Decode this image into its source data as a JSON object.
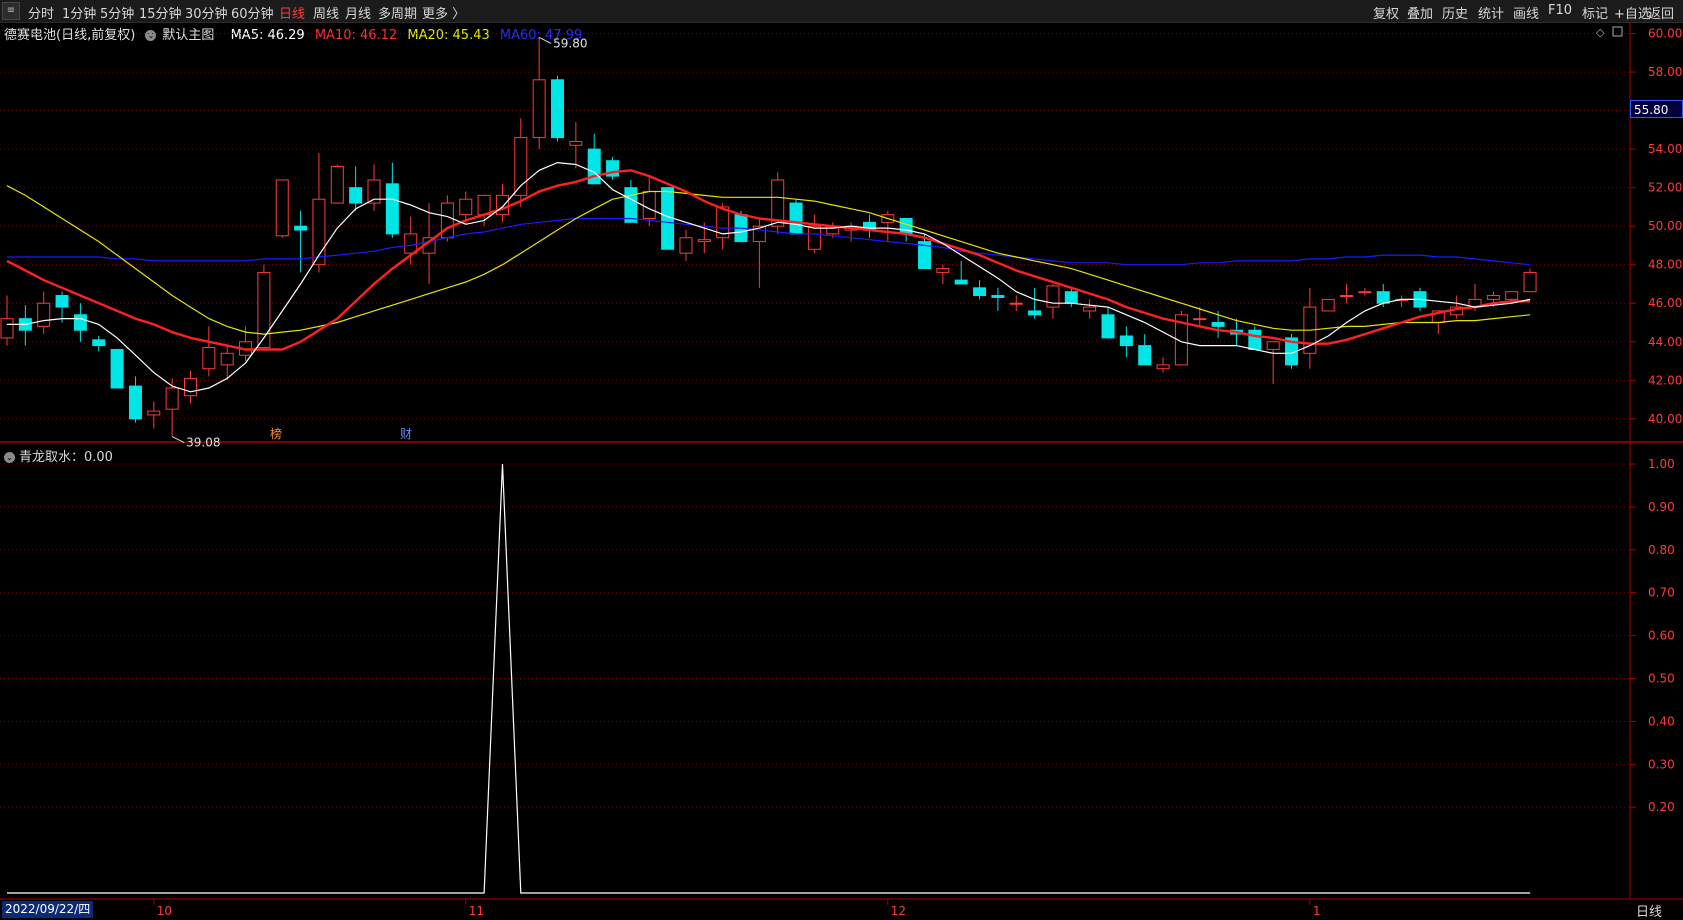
{
  "toolbar": {
    "menu_icon": "menu-icon",
    "periods": [
      "分时",
      "1分钟",
      "5分钟",
      "15分钟",
      "30分钟",
      "60分钟",
      "日线",
      "周线",
      "月线",
      "多周期",
      "更多 〉"
    ],
    "active_period": "日线",
    "right_buttons": [
      "复权",
      "叠加",
      "历史",
      "统计",
      "画线",
      "F10",
      "标记",
      "+自选",
      "返回"
    ]
  },
  "main_chart": {
    "stock_name": "德赛电池(日线,前复权)",
    "template": "默认主图",
    "ma5_label": "MA5: 46.29",
    "ma10_label": "MA10: 46.12",
    "ma20_label": "MA20: 45.43",
    "ma60_label": "MA60: 47.99",
    "high_label": "59.80",
    "low_label": "39.08",
    "current_price": "55.80",
    "marker_1": "榜",
    "marker_2": "财"
  },
  "indicator": {
    "label": "青龙取水：0.00"
  },
  "bottom": {
    "date": "2022/09/22/四",
    "period": "日线"
  },
  "colors": {
    "up": "#ff3a3a",
    "down": "#00e5e5",
    "ma5": "#ffffff",
    "ma10": "#ff2020",
    "ma20": "#e5e500",
    "ma60": "#1a1aff",
    "grid": "#7a0000",
    "axis": "#aa0000"
  },
  "chart_data": [
    {
      "type": "candlestick",
      "title": "",
      "ylim": [
        38.9,
        60.6
      ],
      "y_ticks": [
        40,
        42,
        44,
        46,
        48,
        50,
        52,
        54,
        56,
        58,
        60
      ],
      "x_labels": [
        {
          "label": "10",
          "index": 8
        },
        {
          "label": "11",
          "index": 25
        },
        {
          "label": "12",
          "index": 48
        },
        {
          "label": "1",
          "index": 71
        }
      ],
      "candles": [
        {
          "o": 44.2,
          "h": 46.4,
          "l": 43.8,
          "c": 45.2
        },
        {
          "o": 45.2,
          "h": 45.9,
          "l": 43.8,
          "c": 44.6
        },
        {
          "o": 44.8,
          "h": 46.6,
          "l": 44.4,
          "c": 46.0
        },
        {
          "o": 46.4,
          "h": 46.6,
          "l": 45.0,
          "c": 45.8
        },
        {
          "o": 45.4,
          "h": 46.0,
          "l": 44.0,
          "c": 44.6
        },
        {
          "o": 44.1,
          "h": 44.3,
          "l": 43.5,
          "c": 43.8
        },
        {
          "o": 43.6,
          "h": 43.6,
          "l": 41.6,
          "c": 41.6
        },
        {
          "o": 41.7,
          "h": 42.2,
          "l": 39.8,
          "c": 40.0
        },
        {
          "o": 40.2,
          "h": 40.9,
          "l": 39.5,
          "c": 40.4
        },
        {
          "o": 40.5,
          "h": 42.1,
          "l": 39.1,
          "c": 41.6
        },
        {
          "o": 41.2,
          "h": 42.5,
          "l": 40.8,
          "c": 42.1
        },
        {
          "o": 42.6,
          "h": 44.8,
          "l": 42.2,
          "c": 43.7
        },
        {
          "o": 42.8,
          "h": 43.8,
          "l": 42.0,
          "c": 43.4
        },
        {
          "o": 43.3,
          "h": 44.8,
          "l": 43.0,
          "c": 44.0
        },
        {
          "o": 43.7,
          "h": 48.0,
          "l": 43.6,
          "c": 47.6
        },
        {
          "o": 49.5,
          "h": 52.4,
          "l": 49.4,
          "c": 52.4
        },
        {
          "o": 50.0,
          "h": 50.8,
          "l": 47.6,
          "c": 49.8
        },
        {
          "o": 48.0,
          "h": 53.8,
          "l": 47.6,
          "c": 51.4
        },
        {
          "o": 51.2,
          "h": 53.2,
          "l": 51.2,
          "c": 53.1
        },
        {
          "o": 52.0,
          "h": 53.1,
          "l": 50.8,
          "c": 51.2
        },
        {
          "o": 51.2,
          "h": 53.2,
          "l": 50.8,
          "c": 52.4
        },
        {
          "o": 52.2,
          "h": 53.3,
          "l": 49.4,
          "c": 49.6
        },
        {
          "o": 48.6,
          "h": 50.5,
          "l": 48.0,
          "c": 49.6
        },
        {
          "o": 48.6,
          "h": 51.2,
          "l": 47.0,
          "c": 49.4
        },
        {
          "o": 49.4,
          "h": 51.6,
          "l": 49.2,
          "c": 51.2
        },
        {
          "o": 50.6,
          "h": 51.8,
          "l": 50.1,
          "c": 51.4
        },
        {
          "o": 50.6,
          "h": 51.6,
          "l": 50.0,
          "c": 51.6
        },
        {
          "o": 50.6,
          "h": 52.2,
          "l": 50.2,
          "c": 51.6
        },
        {
          "o": 51.6,
          "h": 55.6,
          "l": 51.0,
          "c": 54.6
        },
        {
          "o": 54.6,
          "h": 59.8,
          "l": 54.0,
          "c": 57.6
        },
        {
          "o": 57.6,
          "h": 57.8,
          "l": 54.4,
          "c": 54.6
        },
        {
          "o": 54.2,
          "h": 55.4,
          "l": 53.0,
          "c": 54.4
        },
        {
          "o": 54.0,
          "h": 54.8,
          "l": 52.2,
          "c": 52.2
        },
        {
          "o": 53.4,
          "h": 53.6,
          "l": 52.4,
          "c": 52.6
        },
        {
          "o": 52.0,
          "h": 52.4,
          "l": 50.2,
          "c": 50.2
        },
        {
          "o": 50.4,
          "h": 52.6,
          "l": 50.0,
          "c": 51.8
        },
        {
          "o": 52.0,
          "h": 52.0,
          "l": 48.8,
          "c": 48.8
        },
        {
          "o": 48.6,
          "h": 49.8,
          "l": 48.2,
          "c": 49.4
        },
        {
          "o": 49.2,
          "h": 50.2,
          "l": 48.6,
          "c": 49.3
        },
        {
          "o": 49.4,
          "h": 51.2,
          "l": 48.8,
          "c": 51.0
        },
        {
          "o": 50.6,
          "h": 50.8,
          "l": 49.2,
          "c": 49.2
        },
        {
          "o": 49.2,
          "h": 50.4,
          "l": 46.8,
          "c": 50.0
        },
        {
          "o": 50.0,
          "h": 52.8,
          "l": 49.6,
          "c": 52.4
        },
        {
          "o": 51.2,
          "h": 51.4,
          "l": 49.6,
          "c": 49.6
        },
        {
          "o": 48.8,
          "h": 50.6,
          "l": 48.6,
          "c": 50.0
        },
        {
          "o": 49.6,
          "h": 50.2,
          "l": 49.4,
          "c": 50.0
        },
        {
          "o": 49.8,
          "h": 50.2,
          "l": 49.2,
          "c": 50.0
        },
        {
          "o": 50.2,
          "h": 50.6,
          "l": 49.4,
          "c": 49.8
        },
        {
          "o": 50.2,
          "h": 50.8,
          "l": 49.2,
          "c": 50.6
        },
        {
          "o": 50.4,
          "h": 50.4,
          "l": 49.2,
          "c": 49.6
        },
        {
          "o": 49.2,
          "h": 49.6,
          "l": 47.8,
          "c": 47.8
        },
        {
          "o": 47.6,
          "h": 48.0,
          "l": 47.0,
          "c": 47.8
        },
        {
          "o": 47.2,
          "h": 48.2,
          "l": 47.0,
          "c": 47.0
        },
        {
          "o": 46.8,
          "h": 47.2,
          "l": 46.2,
          "c": 46.4
        },
        {
          "o": 46.4,
          "h": 46.8,
          "l": 45.6,
          "c": 46.3
        },
        {
          "o": 46.0,
          "h": 46.4,
          "l": 45.6,
          "c": 46.0
        },
        {
          "o": 45.6,
          "h": 46.8,
          "l": 45.2,
          "c": 45.4
        },
        {
          "o": 45.8,
          "h": 47.0,
          "l": 45.2,
          "c": 46.9
        },
        {
          "o": 46.6,
          "h": 46.8,
          "l": 45.8,
          "c": 46.0
        },
        {
          "o": 45.6,
          "h": 46.2,
          "l": 45.2,
          "c": 45.8
        },
        {
          "o": 45.4,
          "h": 45.8,
          "l": 44.2,
          "c": 44.2
        },
        {
          "o": 44.3,
          "h": 44.8,
          "l": 43.2,
          "c": 43.8
        },
        {
          "o": 43.8,
          "h": 44.4,
          "l": 42.8,
          "c": 42.8
        },
        {
          "o": 42.6,
          "h": 43.2,
          "l": 42.4,
          "c": 42.8
        },
        {
          "o": 42.8,
          "h": 45.6,
          "l": 42.8,
          "c": 45.4
        },
        {
          "o": 45.2,
          "h": 45.8,
          "l": 44.8,
          "c": 45.2
        },
        {
          "o": 45.0,
          "h": 45.6,
          "l": 44.2,
          "c": 44.8
        },
        {
          "o": 44.6,
          "h": 45.2,
          "l": 43.8,
          "c": 44.4
        },
        {
          "o": 44.6,
          "h": 44.8,
          "l": 43.6,
          "c": 43.6
        },
        {
          "o": 43.6,
          "h": 44.0,
          "l": 41.8,
          "c": 44.0
        },
        {
          "o": 44.2,
          "h": 44.4,
          "l": 42.6,
          "c": 42.8
        },
        {
          "o": 43.4,
          "h": 46.8,
          "l": 42.6,
          "c": 45.8
        },
        {
          "o": 45.6,
          "h": 46.2,
          "l": 45.6,
          "c": 46.2
        },
        {
          "o": 46.4,
          "h": 47.0,
          "l": 46.0,
          "c": 46.4
        },
        {
          "o": 46.6,
          "h": 46.8,
          "l": 46.4,
          "c": 46.6
        },
        {
          "o": 46.6,
          "h": 47.0,
          "l": 45.8,
          "c": 46.0
        },
        {
          "o": 46.2,
          "h": 46.4,
          "l": 45.8,
          "c": 46.2
        },
        {
          "o": 46.6,
          "h": 46.8,
          "l": 45.6,
          "c": 45.8
        },
        {
          "o": 45.0,
          "h": 45.6,
          "l": 44.4,
          "c": 45.6
        },
        {
          "o": 45.4,
          "h": 46.4,
          "l": 45.2,
          "c": 45.8
        },
        {
          "o": 45.8,
          "h": 47.0,
          "l": 45.6,
          "c": 46.2
        },
        {
          "o": 46.2,
          "h": 46.6,
          "l": 45.8,
          "c": 46.4
        },
        {
          "o": 46.2,
          "h": 46.6,
          "l": 46.0,
          "c": 46.6
        },
        {
          "o": 46.6,
          "h": 47.8,
          "l": 46.6,
          "c": 47.6
        }
      ],
      "ma5": [
        44.9,
        44.9,
        45.1,
        45.2,
        45.2,
        44.9,
        44.2,
        43.3,
        42.4,
        41.7,
        41.4,
        41.6,
        42.1,
        42.9,
        44.2,
        45.6,
        47.0,
        48.5,
        49.9,
        50.9,
        51.4,
        51.4,
        51.1,
        50.7,
        50.5,
        50.1,
        50.3,
        51.0,
        52.1,
        52.9,
        53.3,
        53.2,
        52.8,
        51.9,
        51.4,
        50.9,
        50.5,
        50.2,
        49.9,
        49.6,
        49.7,
        49.9,
        50.2,
        50.1,
        49.9,
        49.9,
        50.0,
        49.9,
        49.9,
        49.8,
        49.6,
        49.1,
        48.5,
        47.9,
        47.3,
        46.6,
        46.2,
        46.0,
        46.0,
        45.9,
        45.8,
        45.4,
        45.0,
        44.5,
        44.0,
        43.8,
        43.8,
        43.8,
        43.6,
        43.4,
        43.4,
        43.8,
        44.3,
        45.0,
        45.6,
        46.0,
        46.2,
        46.2,
        46.1,
        46.0,
        45.8,
        45.9,
        46.0,
        46.2
      ],
      "ma10": [
        48.2,
        47.7,
        47.2,
        46.8,
        46.4,
        46.0,
        45.6,
        45.2,
        44.9,
        44.5,
        44.2,
        44.0,
        43.8,
        43.6,
        43.6,
        43.6,
        44.0,
        44.6,
        45.2,
        46.1,
        47.0,
        47.8,
        48.5,
        49.2,
        49.9,
        50.3,
        50.6,
        50.9,
        51.3,
        51.8,
        52.1,
        52.3,
        52.6,
        52.8,
        52.9,
        52.6,
        52.2,
        51.8,
        51.3,
        50.9,
        50.6,
        50.4,
        50.3,
        50.2,
        50.1,
        50.0,
        49.9,
        49.8,
        49.7,
        49.6,
        49.4,
        49.1,
        48.8,
        48.5,
        48.1,
        47.7,
        47.4,
        47.1,
        46.8,
        46.5,
        46.2,
        45.8,
        45.5,
        45.2,
        45.0,
        44.8,
        44.6,
        44.5,
        44.3,
        44.2,
        44.0,
        43.9,
        43.9,
        44.1,
        44.4,
        44.7,
        45.0,
        45.3,
        45.5,
        45.7,
        45.8,
        46.0,
        46.1,
        46.1
      ],
      "ma20": [
        52.1,
        51.6,
        51.0,
        50.4,
        49.8,
        49.2,
        48.5,
        47.8,
        47.1,
        46.4,
        45.8,
        45.2,
        44.8,
        44.5,
        44.4,
        44.5,
        44.6,
        44.8,
        45.0,
        45.3,
        45.6,
        45.9,
        46.2,
        46.5,
        46.8,
        47.1,
        47.5,
        48.0,
        48.6,
        49.2,
        49.8,
        50.4,
        50.9,
        51.4,
        51.6,
        51.8,
        51.8,
        51.7,
        51.6,
        51.5,
        51.5,
        51.5,
        51.5,
        51.4,
        51.3,
        51.1,
        50.9,
        50.7,
        50.4,
        50.1,
        49.8,
        49.5,
        49.2,
        48.9,
        48.6,
        48.4,
        48.2,
        48.0,
        47.8,
        47.5,
        47.2,
        46.9,
        46.6,
        46.3,
        46.0,
        45.7,
        45.4,
        45.1,
        44.9,
        44.7,
        44.6,
        44.6,
        44.7,
        44.8,
        44.8,
        44.9,
        45.0,
        45.0,
        45.0,
        45.1,
        45.1,
        45.2,
        45.3,
        45.4
      ],
      "ma60": [
        48.4,
        48.4,
        48.4,
        48.4,
        48.4,
        48.4,
        48.3,
        48.3,
        48.2,
        48.2,
        48.2,
        48.2,
        48.2,
        48.2,
        48.3,
        48.3,
        48.3,
        48.4,
        48.5,
        48.6,
        48.7,
        48.9,
        49.0,
        49.2,
        49.4,
        49.6,
        49.7,
        49.9,
        50.1,
        50.2,
        50.3,
        50.4,
        50.4,
        50.4,
        50.4,
        50.3,
        50.2,
        50.1,
        50.0,
        49.9,
        49.9,
        49.8,
        49.7,
        49.6,
        49.6,
        49.5,
        49.4,
        49.3,
        49.2,
        49.1,
        49.0,
        48.9,
        48.7,
        48.6,
        48.5,
        48.4,
        48.3,
        48.2,
        48.1,
        48.1,
        48.1,
        48.0,
        48.0,
        48.0,
        48.0,
        48.1,
        48.1,
        48.2,
        48.2,
        48.2,
        48.2,
        48.3,
        48.3,
        48.4,
        48.4,
        48.5,
        48.5,
        48.5,
        48.4,
        48.4,
        48.3,
        48.2,
        48.1,
        48.0
      ],
      "annotations": [
        {
          "text": "59.80",
          "index": 29,
          "value": 59.8
        },
        {
          "text": "39.08",
          "index": 9,
          "value": 39.08
        }
      ]
    },
    {
      "type": "line",
      "title": "",
      "ylim": [
        0,
        1.0
      ],
      "y_ticks": [
        0.2,
        0.3,
        0.4,
        0.5,
        0.6,
        0.7,
        0.8,
        0.9,
        1.0
      ],
      "series": [
        {
          "name": "青龙取水",
          "values": [
            0,
            0,
            0,
            0,
            0,
            0,
            0,
            0,
            0,
            0,
            0,
            0,
            0,
            0,
            0,
            0,
            0,
            0,
            0,
            0,
            0,
            0,
            0,
            0,
            0,
            0,
            0,
            1,
            0,
            0,
            0,
            0,
            0,
            0,
            0,
            0,
            0,
            0,
            0,
            0,
            0,
            0,
            0,
            0,
            0,
            0,
            0,
            0,
            0,
            0,
            0,
            0,
            0,
            0,
            0,
            0,
            0,
            0,
            0,
            0,
            0,
            0,
            0,
            0,
            0,
            0,
            0,
            0,
            0,
            0,
            0,
            0,
            0,
            0,
            0,
            0,
            0,
            0,
            0,
            0,
            0,
            0,
            0,
            0
          ]
        }
      ]
    }
  ]
}
